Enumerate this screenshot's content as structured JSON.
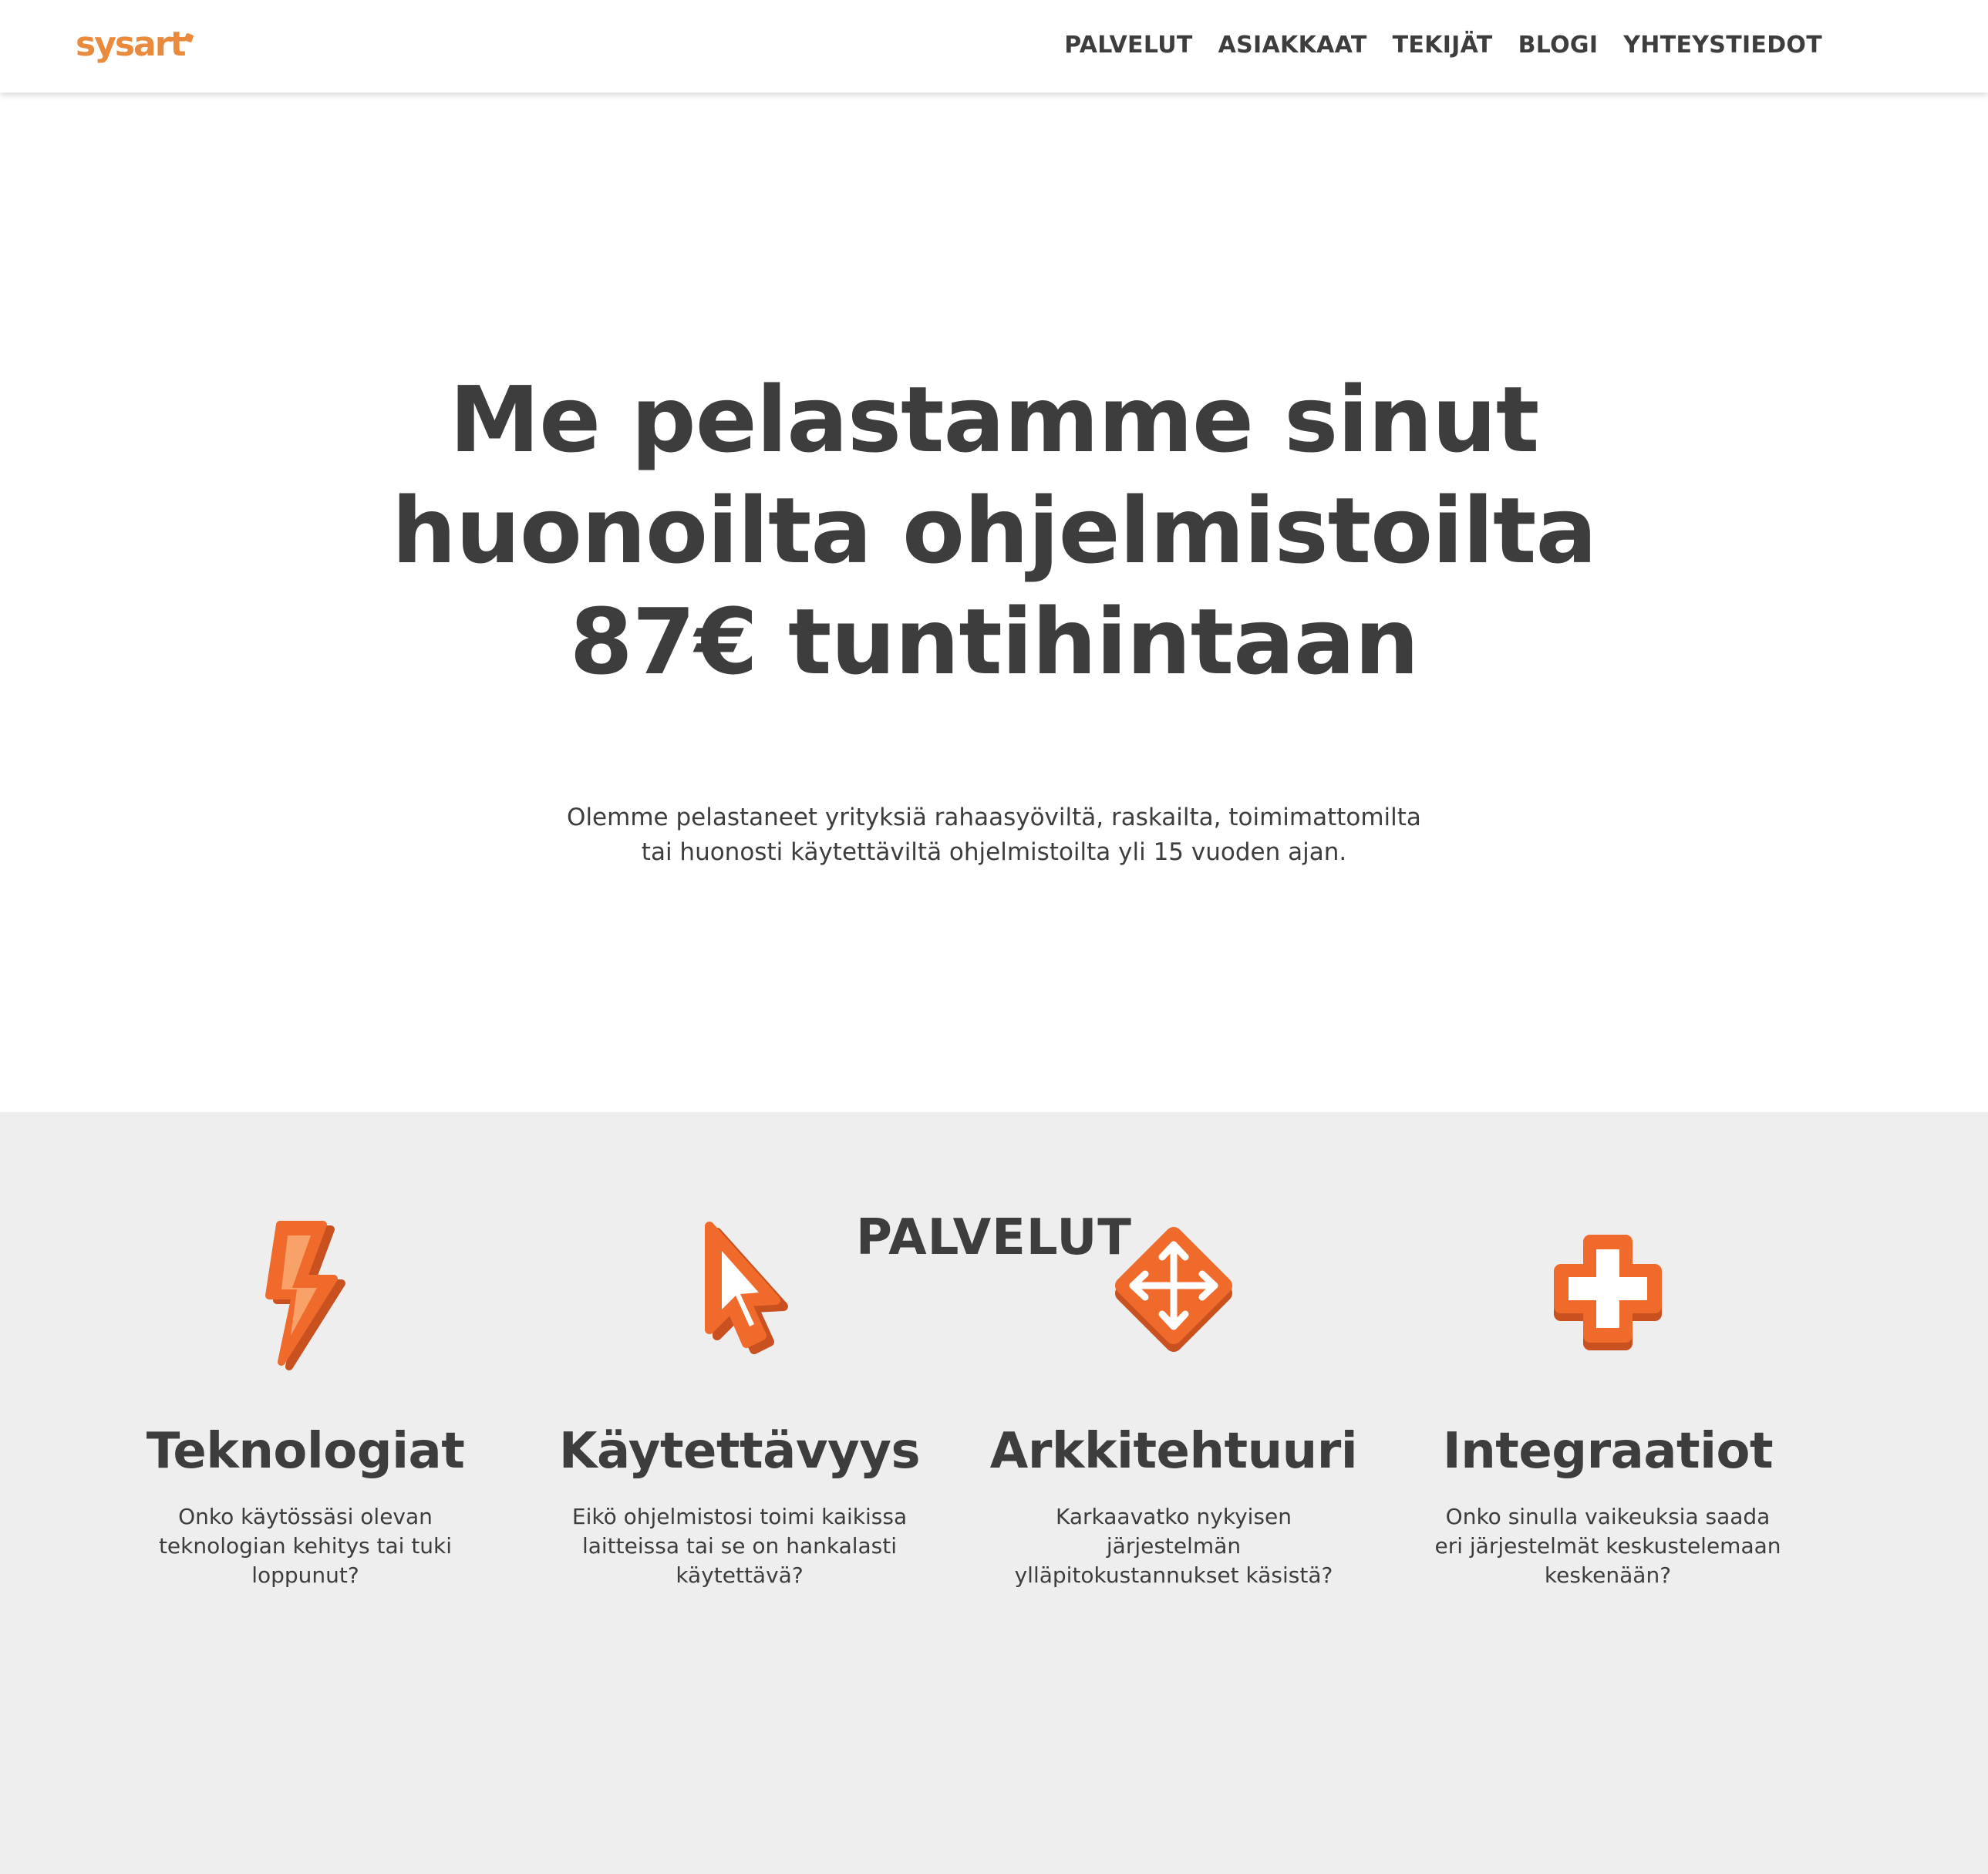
{
  "header": {
    "logo_text": "sysart",
    "nav": [
      "PALVELUT",
      "ASIAKKAAT",
      "TEKIJÄT",
      "BLOGI",
      "YHTEYSTIEDOT"
    ]
  },
  "hero": {
    "title_lines": [
      "Me pelastamme sinut",
      "huonoilta ohjelmistoilta",
      "87€ tuntihintaan"
    ],
    "subtitle_lines": [
      "Olemme pelastaneet yrityksiä rahaasyöviltä, raskailta, toimimattomilta",
      "tai huonosti käytettäviltä ohjelmistoilta yli 15 vuoden ajan."
    ]
  },
  "services": {
    "heading": "PALVELUT",
    "items": [
      {
        "icon": "lightning-bolt-icon",
        "title": "Teknologiat",
        "desc_lines": [
          "Onko käytössäsi olevan",
          "teknologian kehitys tai tuki",
          "loppunut?"
        ]
      },
      {
        "icon": "cursor-arrow-icon",
        "title": "Käytettävyys",
        "desc_lines": [
          "Eikö ohjelmistosi toimi kaikissa",
          "laitteissa tai se on hankalasti",
          "käytettävä?"
        ]
      },
      {
        "icon": "move-arrows-icon",
        "title": "Arkkitehtuuri",
        "desc_lines": [
          "Karkaavatko nykyisen",
          "järjestelmän",
          "ylläpitokustannukset käsistä?"
        ]
      },
      {
        "icon": "plus-cross-icon",
        "title": "Integraatiot",
        "desc_lines": [
          "Onko sinulla vaikeuksia saada",
          "eri järjestelmät keskustelemaan",
          "keskenään?"
        ]
      }
    ]
  },
  "colors": {
    "brand_orange": "#e98a3c",
    "icon_orange": "#ef6a2b",
    "text_dark": "#3d3d3d",
    "section_grey": "#eeeeee"
  }
}
